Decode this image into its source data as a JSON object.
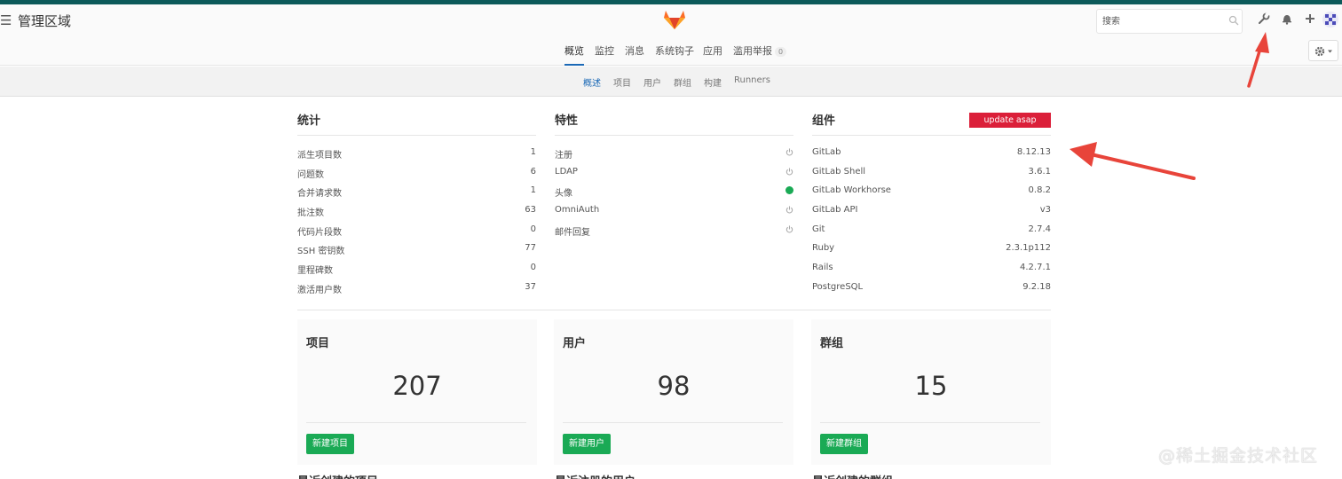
{
  "header": {
    "page_title": "管理区域",
    "search_placeholder": "搜索",
    "icons": [
      "hamburger-icon",
      "gitlab-logo",
      "search-icon",
      "wrench-icon",
      "bell-icon",
      "plus-icon",
      "avatar"
    ]
  },
  "tabs": [
    {
      "label": "概览",
      "active": true
    },
    {
      "label": "监控"
    },
    {
      "label": "消息"
    },
    {
      "label": "系统钩子"
    },
    {
      "label": "应用"
    },
    {
      "label": "滥用举报",
      "badge": "0"
    }
  ],
  "subnav": [
    {
      "label": "概述",
      "active": true
    },
    {
      "label": "项目"
    },
    {
      "label": "用户"
    },
    {
      "label": "群组"
    },
    {
      "label": "构建"
    },
    {
      "label": "Runners"
    }
  ],
  "stats": {
    "title": "统计",
    "rows": [
      {
        "k": "派生项目数",
        "v": "1"
      },
      {
        "k": "问题数",
        "v": "6"
      },
      {
        "k": "合并请求数",
        "v": "1"
      },
      {
        "k": "批注数",
        "v": "63"
      },
      {
        "k": "代码片段数",
        "v": "0"
      },
      {
        "k": "SSH 密钥数",
        "v": "77"
      },
      {
        "k": "里程碑数",
        "v": "0"
      },
      {
        "k": "激活用户数",
        "v": "37"
      }
    ]
  },
  "features": {
    "title": "特性",
    "rows": [
      {
        "k": "注册",
        "state": "off"
      },
      {
        "k": "LDAP",
        "state": "off"
      },
      {
        "k": "头像",
        "state": "on"
      },
      {
        "k": "OmniAuth",
        "state": "off"
      },
      {
        "k": "邮件回复",
        "state": "off"
      }
    ]
  },
  "components": {
    "title": "组件",
    "update_label": "update asap",
    "update_color": "#db1f39",
    "rows": [
      {
        "k": "GitLab",
        "v": "8.12.13"
      },
      {
        "k": "GitLab Shell",
        "v": "3.6.1"
      },
      {
        "k": "GitLab Workhorse",
        "v": "0.8.2"
      },
      {
        "k": "GitLab API",
        "v": "v3"
      },
      {
        "k": "Git",
        "v": "2.7.4"
      },
      {
        "k": "Ruby",
        "v": "2.3.1p112"
      },
      {
        "k": "Rails",
        "v": "4.2.7.1"
      },
      {
        "k": "PostgreSQL",
        "v": "9.2.18"
      }
    ]
  },
  "cards": [
    {
      "title": "项目",
      "count": "207",
      "button": "新建项目"
    },
    {
      "title": "用户",
      "count": "98",
      "button": "新建用户"
    },
    {
      "title": "群组",
      "count": "15",
      "button": "新建群组"
    }
  ],
  "recent": [
    "最近创建的项目",
    "最近注册的用户",
    "最近创建的群组"
  ],
  "watermark": "@稀土掘金技术社区",
  "colors": {
    "accent": "#1b69b6",
    "success": "#1aaa55",
    "danger": "#db1f39",
    "arrow": "#e8443a"
  }
}
